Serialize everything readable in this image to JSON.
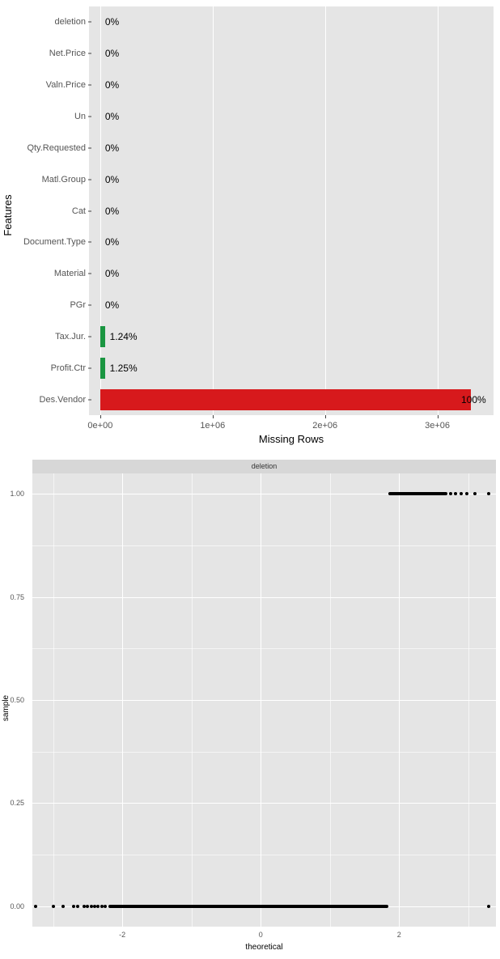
{
  "chart_data": [
    {
      "type": "bar",
      "orientation": "horizontal",
      "title": "",
      "xlabel": "Missing Rows",
      "ylabel": "Features",
      "xlim": [
        0,
        3500000
      ],
      "x_ticks": [
        {
          "val": 0,
          "label": "0e+00"
        },
        {
          "val": 1000000,
          "label": "1e+06"
        },
        {
          "val": 2000000,
          "label": "2e+06"
        },
        {
          "val": 3000000,
          "label": "3e+06"
        }
      ],
      "categories": [
        {
          "name": "deletion",
          "missing": 0,
          "pct_label": "0%",
          "color": "#1a9641"
        },
        {
          "name": "Net.Price",
          "missing": 0,
          "pct_label": "0%",
          "color": "#1a9641"
        },
        {
          "name": "Valn.Price",
          "missing": 0,
          "pct_label": "0%",
          "color": "#1a9641"
        },
        {
          "name": "Un",
          "missing": 0,
          "pct_label": "0%",
          "color": "#1a9641"
        },
        {
          "name": "Qty.Requested",
          "missing": 0,
          "pct_label": "0%",
          "color": "#1a9641"
        },
        {
          "name": "Matl.Group",
          "missing": 0,
          "pct_label": "0%",
          "color": "#1a9641"
        },
        {
          "name": "Cat",
          "missing": 0,
          "pct_label": "0%",
          "color": "#1a9641"
        },
        {
          "name": "Document.Type",
          "missing": 0,
          "pct_label": "0%",
          "color": "#1a9641"
        },
        {
          "name": "Material",
          "missing": 0,
          "pct_label": "0%",
          "color": "#1a9641"
        },
        {
          "name": "PGr",
          "missing": 0,
          "pct_label": "0%",
          "color": "#1a9641"
        },
        {
          "name": "Tax.Jur.",
          "missing": 40920,
          "pct_label": "1.24%",
          "color": "#1a9641"
        },
        {
          "name": "Profit.Ctr",
          "missing": 41250,
          "pct_label": "1.25%",
          "color": "#1a9641"
        },
        {
          "name": "Des.Vendor",
          "missing": 3300000,
          "pct_label": "100%",
          "color": "#d7191c"
        }
      ]
    },
    {
      "type": "scatter",
      "facet_title": "deletion",
      "xlabel": "theoretical",
      "ylabel": "sample",
      "xlim": [
        -3.3,
        3.4
      ],
      "ylim": [
        -0.05,
        1.05
      ],
      "y_ticks": [
        {
          "val": 0.0,
          "label": "0.00"
        },
        {
          "val": 0.25,
          "label": "0.25"
        },
        {
          "val": 0.5,
          "label": "0.50"
        },
        {
          "val": 0.75,
          "label": "0.75"
        },
        {
          "val": 1.0,
          "label": "1.00"
        }
      ],
      "x_ticks": [
        {
          "val": -2,
          "label": "-2"
        },
        {
          "val": 0,
          "label": "0"
        },
        {
          "val": 2,
          "label": "2"
        }
      ],
      "dense_bands": [
        {
          "y": 0,
          "x0": -2.2,
          "x1": 1.85
        },
        {
          "y": 1,
          "x0": 1.85,
          "x1": 2.7
        }
      ],
      "sparse_points": [
        {
          "x": -3.25,
          "y": 0
        },
        {
          "x": -3.0,
          "y": 0
        },
        {
          "x": -2.85,
          "y": 0
        },
        {
          "x": -2.7,
          "y": 0
        },
        {
          "x": -2.65,
          "y": 0
        },
        {
          "x": -2.55,
          "y": 0
        },
        {
          "x": -2.5,
          "y": 0
        },
        {
          "x": -2.45,
          "y": 0
        },
        {
          "x": -2.4,
          "y": 0
        },
        {
          "x": -2.35,
          "y": 0
        },
        {
          "x": -2.3,
          "y": 0
        },
        {
          "x": -2.25,
          "y": 0
        },
        {
          "x": 3.3,
          "y": 0
        },
        {
          "x": 2.75,
          "y": 1
        },
        {
          "x": 2.82,
          "y": 1
        },
        {
          "x": 2.9,
          "y": 1
        },
        {
          "x": 2.98,
          "y": 1
        },
        {
          "x": 3.1,
          "y": 1
        },
        {
          "x": 3.3,
          "y": 1
        }
      ]
    }
  ]
}
